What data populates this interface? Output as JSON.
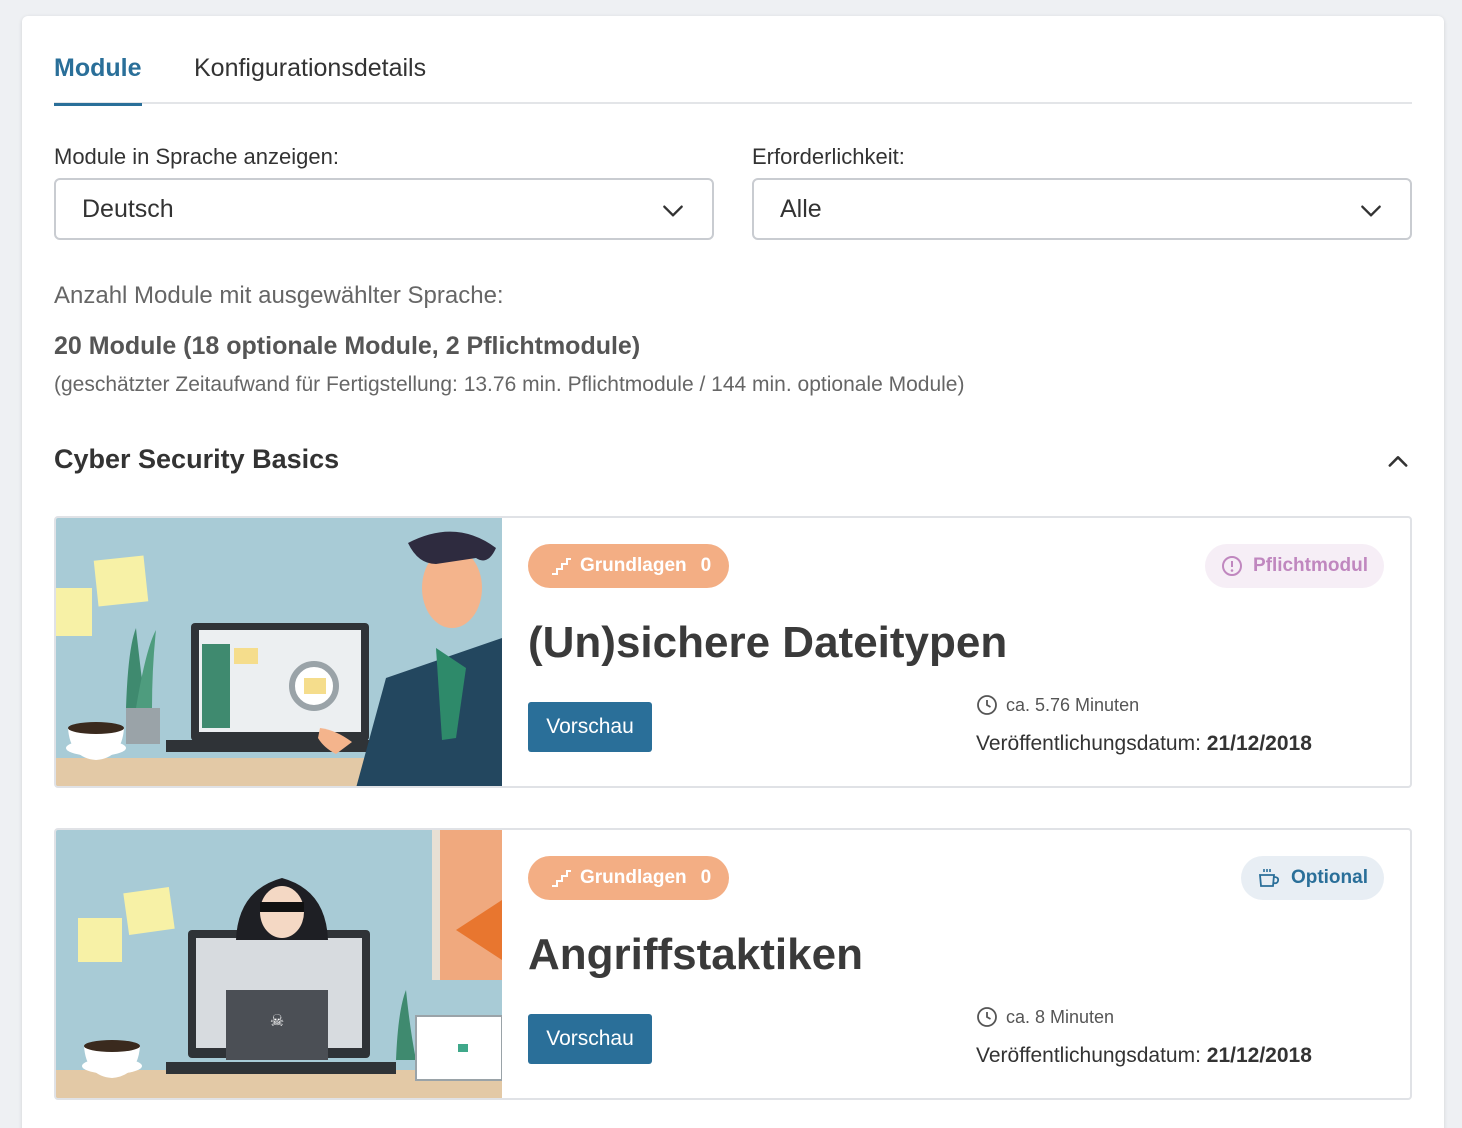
{
  "tabs": [
    {
      "label": "Module",
      "active": true
    },
    {
      "label": "Konfigurationsdetails",
      "active": false
    }
  ],
  "filters": {
    "language": {
      "label": "Module in Sprache anzeigen:",
      "value": "Deutsch"
    },
    "requirement": {
      "label": "Erforderlichkeit:",
      "value": "Alle"
    }
  },
  "summary": {
    "label": "Anzahl Module mit ausgewählter Sprache:",
    "count": "20 Module (18 optionale Module, 2 Pflichtmodule)",
    "time": "(geschätzter Zeitaufwand für Fertigstellung: 13.76 min. Pflichtmodule / 144 min. optionale Module)"
  },
  "section": {
    "title": "Cyber Security Basics"
  },
  "modules": [
    {
      "level_label": "Grundlagen",
      "level_num": "0",
      "requirement": "Pflichtmodul",
      "title": "(Un)sichere Dateitypen",
      "preview_label": "Vorschau",
      "duration": "ca. 5.76 Minuten",
      "pub_label": "Veröffentlichungsdatum:",
      "pub_date": "21/12/2018"
    },
    {
      "level_label": "Grundlagen",
      "level_num": "0",
      "requirement": "Optional",
      "title": "Angriffstaktiken",
      "preview_label": "Vorschau",
      "duration": "ca. 8 Minuten",
      "pub_label": "Veröffentlichungsdatum:",
      "pub_date": "21/12/2018"
    }
  ],
  "colors": {
    "accent": "#2a6f99",
    "level_badge": "#f3ae84",
    "mandatory_badge_bg": "#f6eef6",
    "mandatory_badge_text": "#c087bf",
    "optional_badge_bg": "#e8eef4"
  }
}
